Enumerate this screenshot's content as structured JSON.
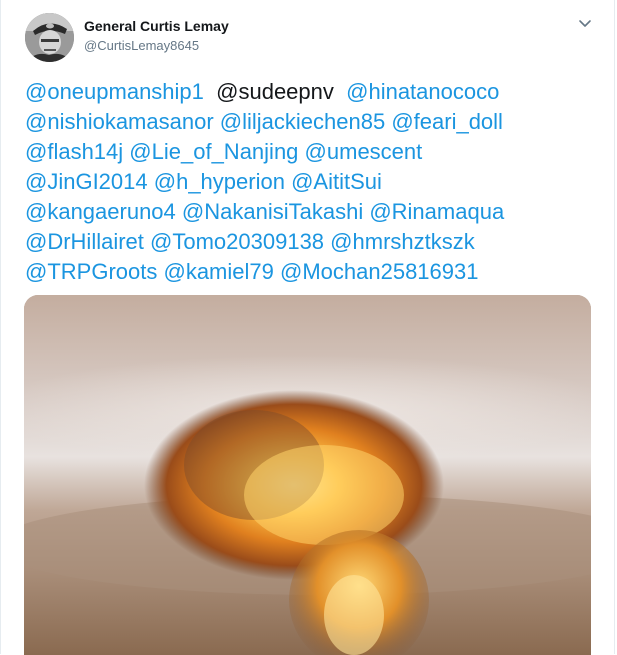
{
  "author": {
    "display_name": "General Curtis Lemay",
    "handle": "@CurtisLemay8645"
  },
  "tweet": {
    "lines": [
      [
        {
          "text": "@oneupmanship1",
          "linked": true
        },
        {
          "text": "@sudeepnv",
          "linked": false
        },
        {
          "text": "@hinatanococo",
          "linked": true
        }
      ],
      [
        {
          "text": "@nishiokamasanor",
          "linked": true
        },
        {
          "text": "@liljackiechen85",
          "linked": true
        },
        {
          "text": "@feari_doll",
          "linked": true
        }
      ],
      [
        {
          "text": "@flash14j",
          "linked": true
        },
        {
          "text": "@Lie_of_Nanjing",
          "linked": true
        },
        {
          "text": "@umescent",
          "linked": true
        }
      ],
      [
        {
          "text": "@JinGI2014",
          "linked": true
        },
        {
          "text": "@h_hyperion",
          "linked": true
        },
        {
          "text": "@AititSui",
          "linked": true
        }
      ],
      [
        {
          "text": "@kangaeruno4",
          "linked": true
        },
        {
          "text": "@NakanisiTakashi",
          "linked": true
        },
        {
          "text": "@Rinamaqua",
          "linked": true
        }
      ],
      [
        {
          "text": "@DrHillairet",
          "linked": true
        },
        {
          "text": "@Tomo20309138",
          "linked": true
        },
        {
          "text": "@hmrshztkszk",
          "linked": true
        }
      ],
      [
        {
          "text": "@TRPGroots",
          "linked": true
        },
        {
          "text": "@kamiel79",
          "linked": true
        },
        {
          "text": "@Mochan25816931",
          "linked": true
        }
      ]
    ]
  },
  "media": {
    "subject": "mushroom-cloud-explosion-image"
  },
  "icons": {
    "caret": "chevron-down-icon",
    "avatar": "avatar-portrait"
  },
  "colors": {
    "mention": "#1b95e0",
    "text": "#14171a",
    "secondary": "#657786",
    "border": "#e6ecf0"
  }
}
